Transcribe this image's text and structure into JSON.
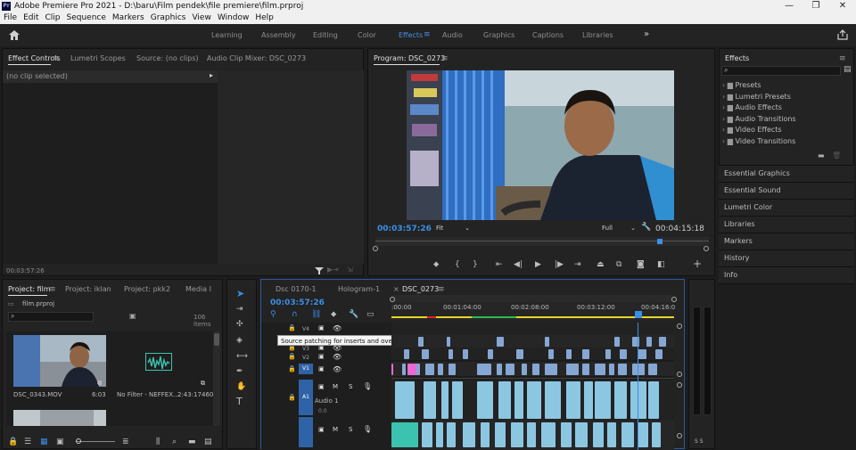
{
  "window": {
    "title": "Adobe Premiere Pro 2021 - D:\\baru\\Film pendek\\file premiere\\film.prproj",
    "app_icon": "Pr",
    "minimize": "—",
    "maximize": "❐",
    "close": "✕"
  },
  "menu": [
    "File",
    "Edit",
    "Clip",
    "Sequence",
    "Markers",
    "Graphics",
    "View",
    "Window",
    "Help"
  ],
  "workspaces": {
    "items": [
      "Learning",
      "Assembly",
      "Editing",
      "Color",
      "Effects",
      "Audio",
      "Graphics",
      "Captions",
      "Libraries"
    ],
    "active": "Effects",
    "more": "»"
  },
  "source_panel": {
    "tabs": [
      "Effect Controls",
      "Lumetri Scopes",
      "Source: (no clips)",
      "Audio Clip Mixer: DSC_0273"
    ],
    "no_clip": "(no clip selected)",
    "timecode": "00:03:57:26"
  },
  "program": {
    "title": "Program: DSC_0273",
    "timecode": "00:03:57:26",
    "fit": "Fit",
    "quality": "Full",
    "duration": "00:04:15:18"
  },
  "effects_panel": {
    "title": "Effects",
    "folders": [
      "Presets",
      "Lumetri Presets",
      "Audio Effects",
      "Audio Transitions",
      "Video Effects",
      "Video Transitions"
    ],
    "sections": [
      "Essential Graphics",
      "Essential Sound",
      "Lumetri Color",
      "Libraries",
      "Markers",
      "History",
      "Info"
    ]
  },
  "project": {
    "tabs": [
      "Project: film",
      "Project: iklan",
      "Project: pkk2",
      "Media I"
    ],
    "file": "film.prproj",
    "count": "106 items",
    "items": [
      {
        "name": "DSC_0343.MOV",
        "duration": "6:03"
      },
      {
        "name": "No Filter - NEFFEX....",
        "duration": "2:43:17460"
      }
    ]
  },
  "timeline": {
    "tabs": [
      "Dsc 0170-1",
      "Hologram-1",
      "DSC_0273"
    ],
    "close": "×",
    "timecode": "00:03:57:26",
    "ruler": [
      ":00:00",
      "00:01:04:00",
      "00:02:08:00",
      "00:03:12:00",
      "00:04:16:0"
    ],
    "tracks": [
      "V4",
      "V3",
      "V2",
      "V1",
      "A1",
      "A2"
    ],
    "track_toggles": {
      "mute": "M",
      "solo": "S"
    },
    "audio_label": "Audio 1",
    "audio_level": "0.0",
    "tooltip": "Source patching for inserts and overwrites.",
    "meter_label": "S S"
  },
  "colors": {
    "accent": "#3b8fe6",
    "video": "#86a7d3",
    "audio": "#8cc7e2",
    "playhead": "#3b8fe6"
  }
}
